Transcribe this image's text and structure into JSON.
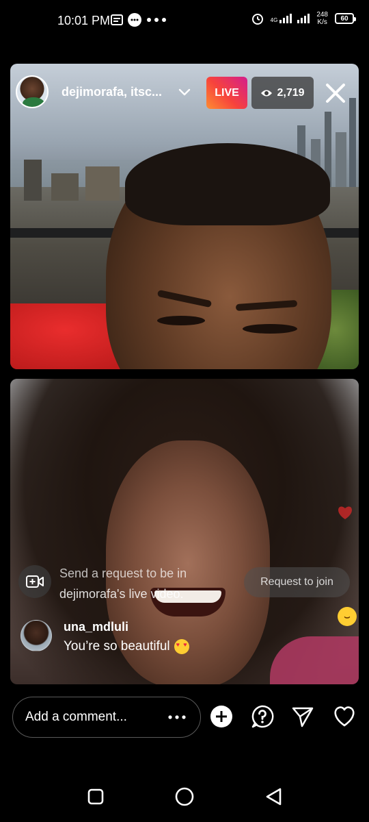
{
  "status_bar": {
    "time": "10:01 PM",
    "network_label": "4G",
    "speed_value": "248",
    "speed_unit": "K/s",
    "battery": "60"
  },
  "live": {
    "host_name": "dejimorafa, itsc...",
    "live_label": "LIVE",
    "viewer_count": "2,719"
  },
  "request": {
    "line1": "Send a request to be in",
    "line2": "dejimorafa's live video.",
    "join_label": "Request to join"
  },
  "comment": {
    "user": "una_mdluli",
    "text": "You’re so beautiful"
  },
  "composer": {
    "placeholder": "Add a comment..."
  },
  "colors": {
    "live_gradient_start": "#fd8d32",
    "live_gradient_end": "#d31e8c",
    "background": "#000000"
  },
  "icons": [
    "message-icon",
    "chat-icon",
    "alarm-icon",
    "signal-icon",
    "battery-icon",
    "chevron-down-icon",
    "eye-icon",
    "close-icon",
    "add-video-icon",
    "heart-icon",
    "laugh-emoji-icon",
    "heart-eyes-emoji-icon",
    "more-icon",
    "plus-icon",
    "question-icon",
    "send-icon",
    "like-icon",
    "nav-recents-icon",
    "nav-home-icon",
    "nav-back-icon"
  ]
}
